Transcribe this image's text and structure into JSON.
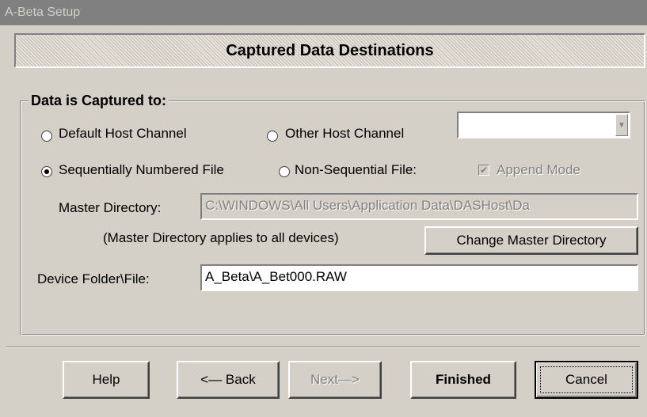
{
  "window": {
    "title": "A-Beta Setup"
  },
  "header": {
    "title": "Captured Data Destinations"
  },
  "group": {
    "legend": "Data is Captured to:"
  },
  "options": {
    "default_host": "Default Host Channel",
    "other_host": "Other Host Channel",
    "other_host_combo_value": "",
    "sequential": "Sequentially Numbered File",
    "non_sequential": "Non-Sequential File:",
    "append_mode": "Append Mode",
    "append_mode_checked": true,
    "selected": "sequential"
  },
  "master": {
    "label": "Master Directory:",
    "value": "C:\\WINDOWS\\All Users\\Application Data\\DASHost\\Da",
    "note": "(Master Directory applies to all devices)",
    "change_button": "Change Master Directory"
  },
  "device": {
    "label": "Device Folder\\File:",
    "value": "A_Beta\\A_Bet000.RAW"
  },
  "buttons": {
    "help": "Help",
    "back": "<— Back",
    "next": "Next—>",
    "finished": "Finished",
    "cancel": "Cancel"
  }
}
